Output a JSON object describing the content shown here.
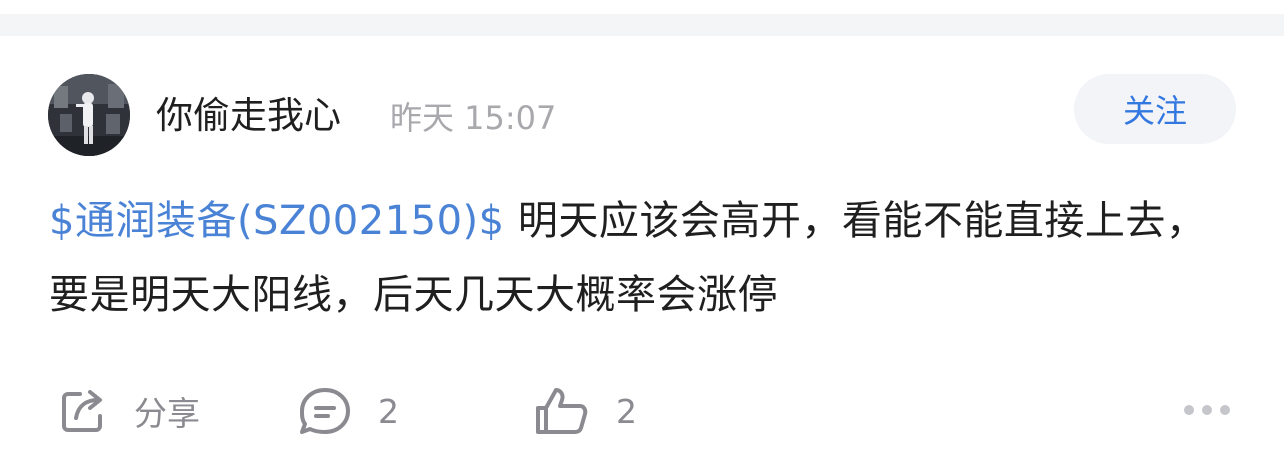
{
  "post": {
    "author": "你偷走我心",
    "time": "昨天 15:07",
    "follow_label": "关注",
    "stock_tag": "$通润装备(SZ002150)$",
    "body_text": " 明天应该会高开，看能不能直接上去，要是明天大阳线，后天几天大概率会涨停"
  },
  "actions": {
    "share_label": "分享",
    "comment_count": "2",
    "like_count": "2"
  },
  "icons": {
    "share": "share-icon",
    "comment": "comment-icon",
    "like": "thumbs-up-icon",
    "more": "more-dots-icon"
  },
  "colors": {
    "accent": "#3377e0",
    "stock_link": "#4a83d6",
    "muted": "#8a8a90"
  }
}
